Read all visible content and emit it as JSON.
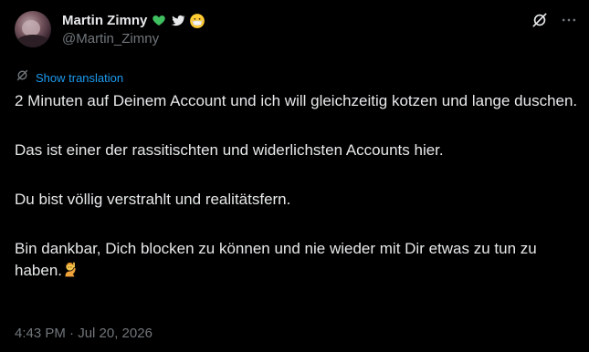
{
  "author": {
    "display_name": "Martin Zimny",
    "handle": "@Martin_Zimny",
    "badges": [
      "green-heart-icon",
      "bird-icon",
      "mask-face-icon"
    ]
  },
  "translate": {
    "label": "Show translation"
  },
  "tweet": {
    "paragraphs": [
      "2 Minuten auf Deinem Account und ich will gleichzeitig kotzen und lange duschen.",
      "Das ist einer der rassitischten und widerlichsten Accounts hier.",
      "Du bist völlig verstrahlt und realitätsfern.",
      "Bin dankbar, Dich blocken zu können und nie wieder mit Dir etwas zu tun zu haben."
    ],
    "trailing_emoji": "person-raising-hand-icon",
    "timestamp": "4:43 PM · Jul 20, 2026"
  },
  "colors": {
    "background": "#000000",
    "text": "#e7e9ea",
    "muted": "#71767b",
    "link": "#1d9bf0",
    "heart": "#3fbf5f"
  }
}
